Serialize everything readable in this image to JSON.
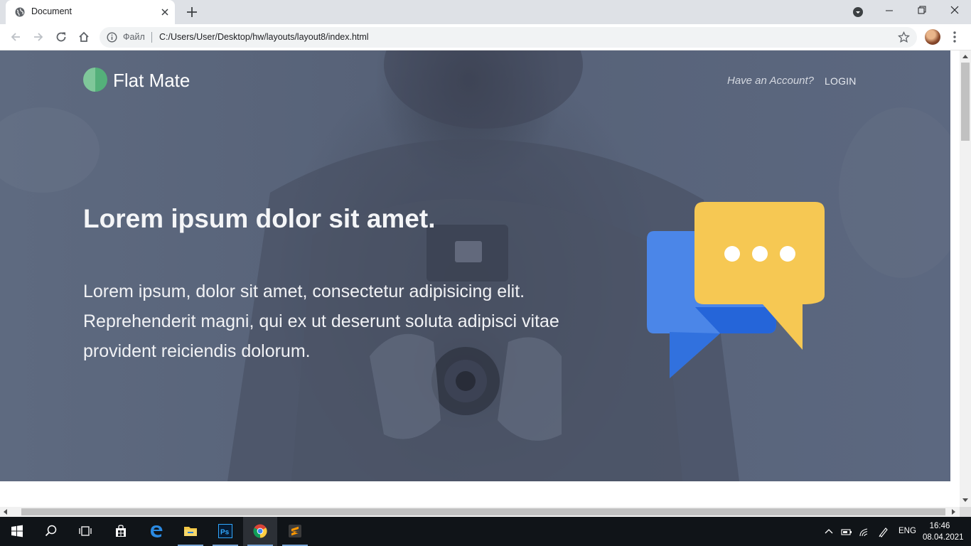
{
  "browser": {
    "tab_title": "Document",
    "address_scheme": "Файл",
    "address_url": "C:/Users/User/Desktop/hw/layouts/layout8/index.html"
  },
  "page": {
    "logo_text": "Flat Mate",
    "account_question": "Have an Account?",
    "login_label": "LOGIN",
    "hero_title": "Lorem ipsum dolor sit amet.",
    "hero_text": "Lorem ipsum, dolor sit amet, consectetur adipisicing elit. Reprehenderit magni, qui ex ut deserunt soluta adipisci vitae provident reiciendis dolorum.",
    "colors": {
      "overlay": "#5b667c",
      "logo_green": "#5fb884",
      "bubble_blue": "#4b86e8",
      "bubble_yellow": "#f6c853"
    }
  },
  "taskbar": {
    "apps": [
      "start-icon",
      "search-icon",
      "task-view-icon",
      "store-icon",
      "edge-icon",
      "file-explorer-icon",
      "photoshop-icon",
      "chrome-icon",
      "sublime-icon"
    ],
    "photoshop_label": "Ps",
    "language": "ENG",
    "time": "16:46",
    "date": "08.04.2021"
  }
}
